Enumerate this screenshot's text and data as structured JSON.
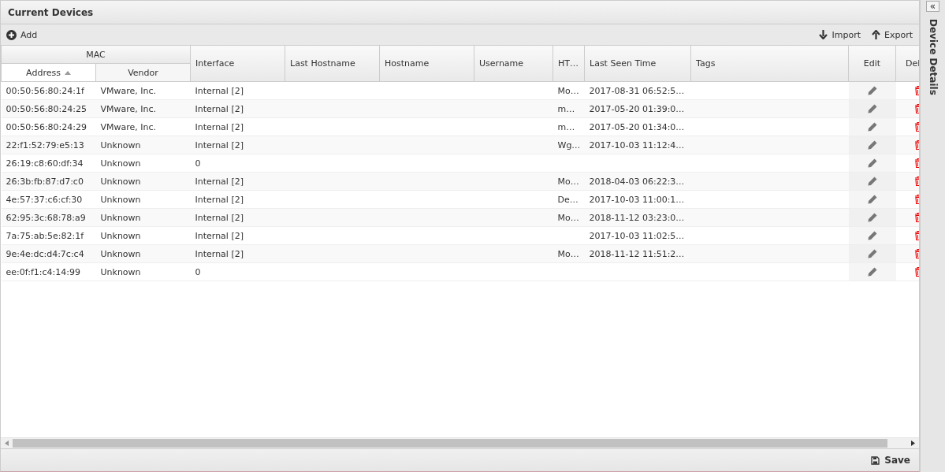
{
  "panel": {
    "title": "Current Devices"
  },
  "toolbar": {
    "add": "Add",
    "import": "Import",
    "export": "Export"
  },
  "table": {
    "group_header": "MAC",
    "columns": [
      {
        "label": "Address",
        "sorted": true
      },
      {
        "label": "Vendor",
        "sorted": false
      },
      {
        "label": "Interface",
        "sorted": false
      },
      {
        "label": "Last Hostname",
        "sorted": false
      },
      {
        "label": "Hostname",
        "sorted": false
      },
      {
        "label": "Username",
        "sorted": false
      },
      {
        "label": "HT…",
        "sorted": false
      },
      {
        "label": "Last Seen Time",
        "sorted": false
      },
      {
        "label": "Tags",
        "sorted": false
      },
      {
        "label": "Edit",
        "sorted": false
      },
      {
        "label": "Del",
        "sorted": false
      }
    ],
    "rows": [
      {
        "address": "00:50:56:80:24:1f",
        "vendor": "VMware, Inc.",
        "interface": "Internal [2]",
        "ht": "Mo…",
        "last_seen": "2017-08-31 06:52:5…"
      },
      {
        "address": "00:50:56:80:24:25",
        "vendor": "VMware, Inc.",
        "interface": "Internal [2]",
        "ht": "m…",
        "last_seen": "2017-05-20 01:39:0…"
      },
      {
        "address": "00:50:56:80:24:29",
        "vendor": "VMware, Inc.",
        "interface": "Internal [2]",
        "ht": "m…",
        "last_seen": "2017-05-20 01:34:0…"
      },
      {
        "address": "22:f1:52:79:e5:13",
        "vendor": "Unknown",
        "interface": "Internal [2]",
        "ht": "Wg…",
        "last_seen": "2017-10-03 11:12:4…"
      },
      {
        "address": "26:19:c8:60:df:34",
        "vendor": "Unknown",
        "interface": "0"
      },
      {
        "address": "26:3b:fb:87:d7:c0",
        "vendor": "Unknown",
        "interface": "Internal [2]",
        "ht": "Mo…",
        "last_seen": "2018-04-03 06:22:3…"
      },
      {
        "address": "4e:57:37:c6:cf:30",
        "vendor": "Unknown",
        "interface": "Internal [2]",
        "ht": "De…",
        "last_seen": "2017-10-03 11:00:1…"
      },
      {
        "address": "62:95:3c:68:78:a9",
        "vendor": "Unknown",
        "interface": "Internal [2]",
        "ht": "Mo…",
        "last_seen": "2018-11-12 03:23:0…"
      },
      {
        "address": "7a:75:ab:5e:82:1f",
        "vendor": "Unknown",
        "interface": "Internal [2]",
        "last_seen": "2017-10-03 11:02:5…"
      },
      {
        "address": "9e:4e:dc:d4:7c:c4",
        "vendor": "Unknown",
        "interface": "Internal [2]",
        "ht": "Mo…",
        "last_seen": "2018-11-12 11:51:2…"
      },
      {
        "address": "ee:0f:f1:c4:14:99",
        "vendor": "Unknown",
        "interface": "0"
      }
    ]
  },
  "footer": {
    "save": "Save"
  },
  "side_panel": {
    "title": "Device Details",
    "collapse": "«"
  }
}
